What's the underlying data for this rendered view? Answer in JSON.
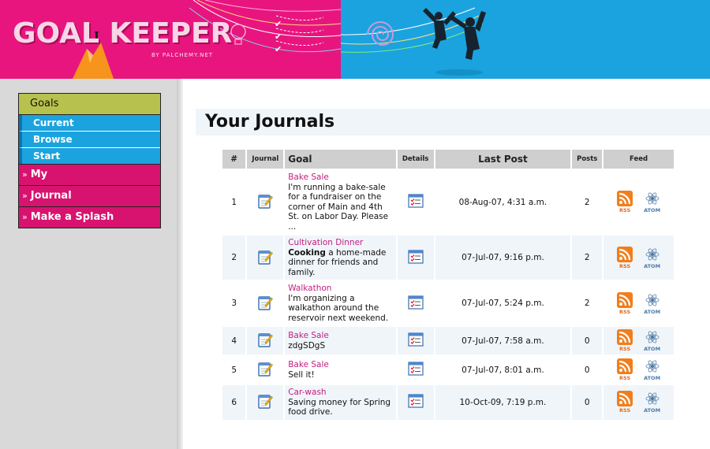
{
  "banner": {
    "logo_text": "GOAL KEEPER",
    "logo_sub": "BY PALCHEMY.NET",
    "colors": {
      "pink": "#e8157f",
      "blue": "#1ba3df"
    }
  },
  "nav": {
    "goals_label": "Goals",
    "sub_items": [
      {
        "label": "Current"
      },
      {
        "label": "Browse"
      },
      {
        "label": "Start"
      }
    ],
    "main_items": [
      {
        "label": "My"
      },
      {
        "label": "Journal"
      },
      {
        "label": "Make a Splash"
      }
    ],
    "arrow": "»"
  },
  "page_title": "Your Journals",
  "table": {
    "headers": {
      "num": "#",
      "journal": "Journal",
      "goal": "Goal",
      "details": "Details",
      "last_post": "Last Post",
      "posts": "Posts",
      "feed": "Feed"
    },
    "feed_labels": {
      "rss": "RSS",
      "atom": "ATOM"
    },
    "icons": {
      "journal": "notepad-check-icon",
      "details": "details-list-icon",
      "rss": "rss-icon",
      "atom": "atom-icon"
    },
    "rows": [
      {
        "num": "1",
        "goal_title": "Bake Sale",
        "desc_bold": "",
        "desc": "I'm running a bake-sale for a fundraiser on the corner of Main and 4th St. on Labor Day. Please ...",
        "last_post": "08-Aug-07, 4:31 a.m.",
        "posts": "2"
      },
      {
        "num": "2",
        "goal_title": "Cultivation Dinner",
        "desc_bold": "Cooking",
        "desc": " a home-made dinner for friends and family.",
        "last_post": "07-Jul-07, 9:16 p.m.",
        "posts": "2"
      },
      {
        "num": "3",
        "goal_title": "Walkathon",
        "desc_bold": "",
        "desc": "I'm organizing a walkathon around the reservoir next weekend.",
        "last_post": "07-Jul-07, 5:24 p.m.",
        "posts": "2"
      },
      {
        "num": "4",
        "goal_title": "Bake Sale",
        "desc_bold": "",
        "desc": "zdgSDgS",
        "last_post": "07-Jul-07, 7:58 a.m.",
        "posts": "0"
      },
      {
        "num": "5",
        "goal_title": "Bake Sale",
        "desc_bold": "",
        "desc": "Sell it!",
        "last_post": "07-Jul-07, 8:01 a.m.",
        "posts": "0"
      },
      {
        "num": "6",
        "goal_title": "Car-wash",
        "desc_bold": "",
        "desc": "Saving money for Spring food drive.",
        "last_post": "10-Oct-09, 7:19 p.m.",
        "posts": "0"
      }
    ]
  }
}
